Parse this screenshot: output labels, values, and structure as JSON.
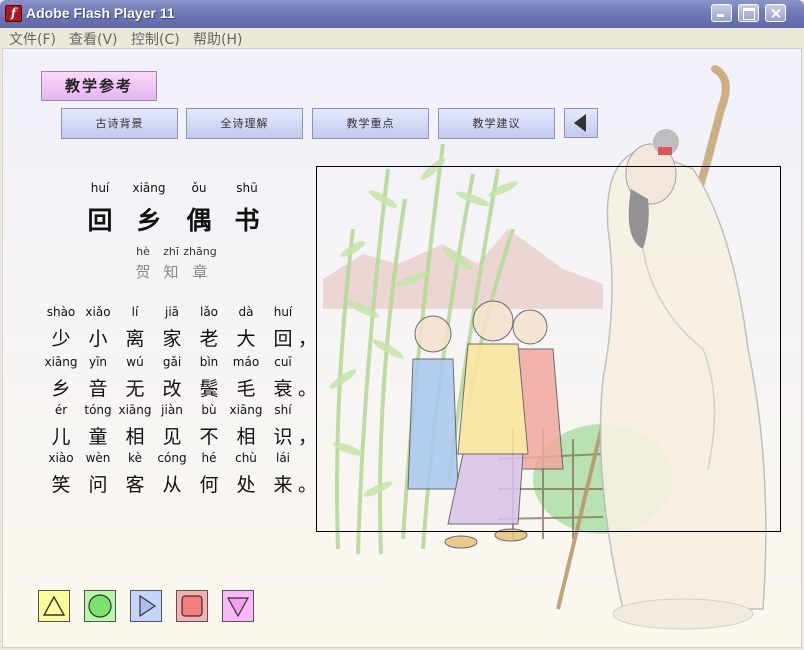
{
  "window": {
    "title": "Adobe Flash Player 11",
    "icon": "flash-player-icon"
  },
  "menu": [
    "文件(F)",
    "查看(V)",
    "控制(C)",
    "帮助(H)"
  ],
  "reference_button": "教学参考",
  "tabs": [
    "古诗背景",
    "全诗理解",
    "教学重点",
    "教学建议"
  ],
  "poem": {
    "title": {
      "pinyin": [
        "huí",
        "xiāng",
        "ǒu",
        "shū"
      ],
      "hanzi": [
        "回",
        "乡",
        "偶",
        "书"
      ]
    },
    "author": {
      "pinyin": [
        "hè",
        "zhī",
        "zhāng"
      ],
      "hanzi": [
        "贺",
        "知",
        "章"
      ]
    },
    "lines": [
      {
        "pinyin": [
          "shào",
          "xiǎo",
          "lí",
          "jiā",
          "lǎo",
          "dà",
          "huí"
        ],
        "hanzi": [
          "少",
          "小",
          "离",
          "家",
          "老",
          "大",
          "回"
        ],
        "punct": "，"
      },
      {
        "pinyin": [
          "xiāng",
          "yīn",
          "wú",
          "gǎi",
          "bìn",
          "máo",
          "cuī"
        ],
        "hanzi": [
          "乡",
          "音",
          "无",
          "改",
          "鬓",
          "毛",
          "衰"
        ],
        "punct": "。"
      },
      {
        "pinyin": [
          "ér",
          "tóng",
          "xiāng",
          "jiàn",
          "bù",
          "xiāng",
          "shí"
        ],
        "hanzi": [
          "儿",
          "童",
          "相",
          "见",
          "不",
          "相",
          "识"
        ],
        "punct": "，"
      },
      {
        "pinyin": [
          "xiào",
          "wèn",
          "kè",
          "cóng",
          "hé",
          "chù",
          "lái"
        ],
        "hanzi": [
          "笑",
          "问",
          "客",
          "从",
          "何",
          "处",
          "来"
        ],
        "punct": "。"
      }
    ]
  },
  "controls": [
    {
      "name": "triangle-button",
      "icon": "triangle-icon",
      "color": "#fdfd9a"
    },
    {
      "name": "circle-button",
      "icon": "circle-icon",
      "color": "#b8f7a8"
    },
    {
      "name": "play-button",
      "icon": "play-icon",
      "color": "#c4d4fb"
    },
    {
      "name": "square-button",
      "icon": "square-icon",
      "color": "#fbb0b0"
    },
    {
      "name": "down-triangle-button",
      "icon": "down-triangle-icon",
      "color": "#fbb8f8"
    }
  ]
}
